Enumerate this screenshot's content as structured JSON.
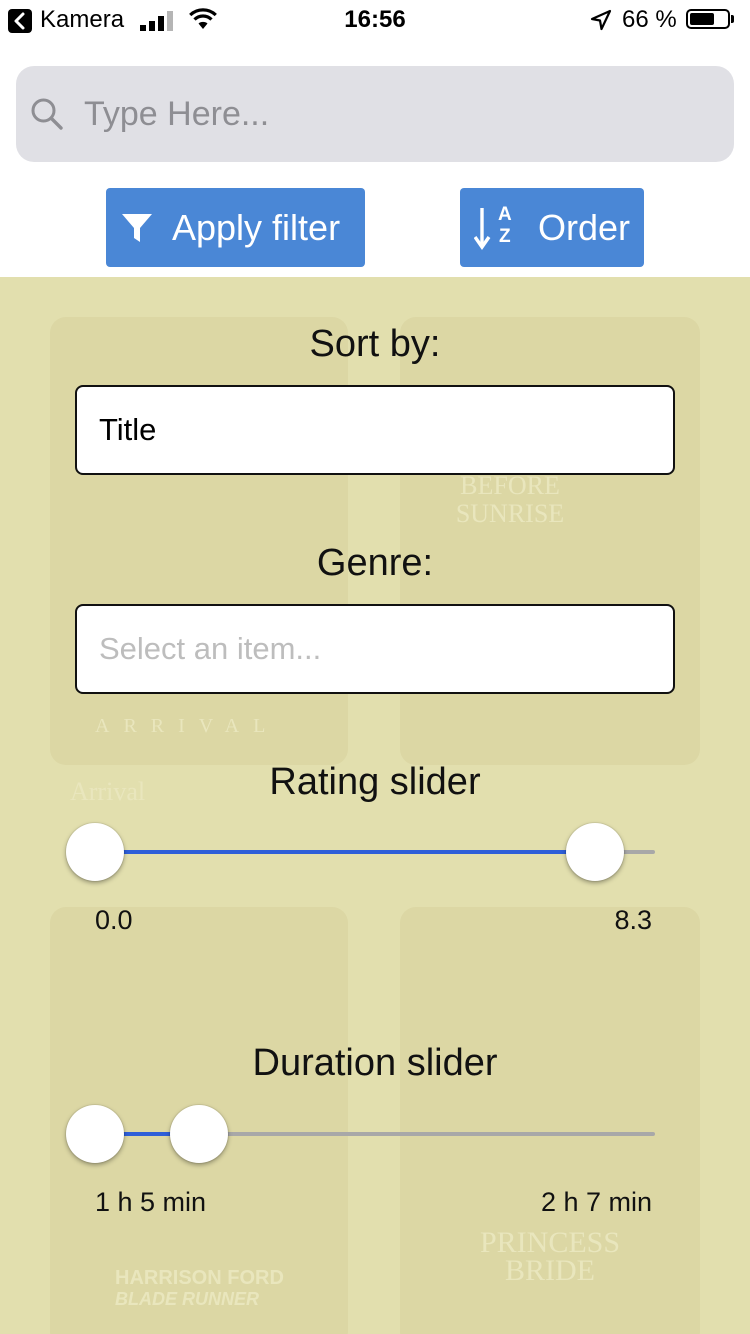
{
  "status_bar": {
    "back_app": "Kamera",
    "time": "16:56",
    "battery_percent": "66 %",
    "battery_level": 0.66
  },
  "search": {
    "placeholder": "Type Here...",
    "value": ""
  },
  "toolbar": {
    "filter_label": "Apply filter",
    "order_label": "Order",
    "order_icon_letters": {
      "top": "A",
      "bottom": "Z"
    }
  },
  "filters": {
    "sort_by_label": "Sort by:",
    "sort_by_value": "Title",
    "genre_label": "Genre:",
    "genre_placeholder": "Select an item...",
    "rating": {
      "label": "Rating slider",
      "min_label": "0.0",
      "max_label": "8.3",
      "low": 0.0,
      "high": 8.3,
      "range": [
        0,
        9.3
      ]
    },
    "duration": {
      "label": "Duration slider",
      "min_label": "1 h 5 min",
      "max_label": "2 h 7 min",
      "low_minutes": 65,
      "high_minutes": 127,
      "range_minutes": [
        65,
        400
      ]
    }
  },
  "background_posters": [
    {
      "title": "ARRIVAL",
      "caption": "Arrival"
    },
    {
      "title": "BEFORE SUNRISE",
      "caption": "Before Sunrise"
    },
    {
      "title": "BLADE RUNNER",
      "caption": "HARRISON FORD"
    },
    {
      "title": "PRINCESS BRIDE",
      "caption": ""
    }
  ],
  "colors": {
    "accent": "#4a87d6",
    "overlay": "#e2dfae",
    "slider_active": "#2e5fd8",
    "slider_inactive": "#a8a8a8",
    "search_bg": "#e0e0e5"
  }
}
